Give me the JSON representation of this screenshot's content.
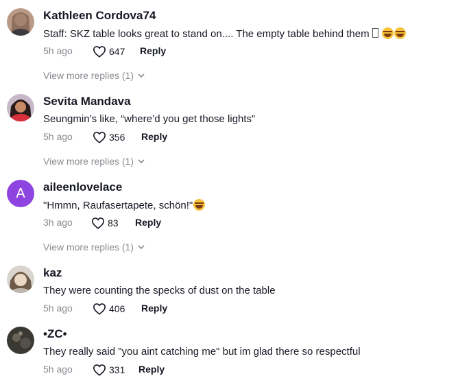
{
  "comments": [
    {
      "username": "Kathleen Cordova74",
      "text": "Staff: SKZ table looks great to stand on.... The empty table behind them",
      "time": "5h ago",
      "likes": "647",
      "reply_label": "Reply",
      "view_more": "View more replies (1)",
      "emoji_count": 2,
      "has_box_glyph": true
    },
    {
      "username": "Sevita Mandava",
      "text": "Seungmin’s like, “where’d you get those lights”",
      "time": "5h ago",
      "likes": "356",
      "reply_label": "Reply",
      "view_more": "View more replies (1)"
    },
    {
      "username": "aileenlovelace",
      "avatar_letter": "A",
      "text": "\"Hmmn, Raufasertapete, schön!\"",
      "time": "3h ago",
      "likes": "83",
      "reply_label": "Reply",
      "view_more": "View more replies (1)",
      "emoji_count": 1
    },
    {
      "username": "kaz",
      "text": "They were counting the specks of dust on the table",
      "time": "5h ago",
      "likes": "406",
      "reply_label": "Reply"
    },
    {
      "username": "•ZC•",
      "text": "They really said \"you aint catching me\" but im glad there so respectful",
      "time": "5h ago",
      "likes": "331",
      "reply_label": "Reply"
    }
  ],
  "icons": {
    "like": "heart-outline-icon",
    "expand": "chevron-down-icon",
    "emoji": "laughing-tears-emoji-icon"
  },
  "colors": {
    "text": "#161823",
    "muted": "#8a8b91",
    "letter_avatar": "#8e44e0"
  }
}
